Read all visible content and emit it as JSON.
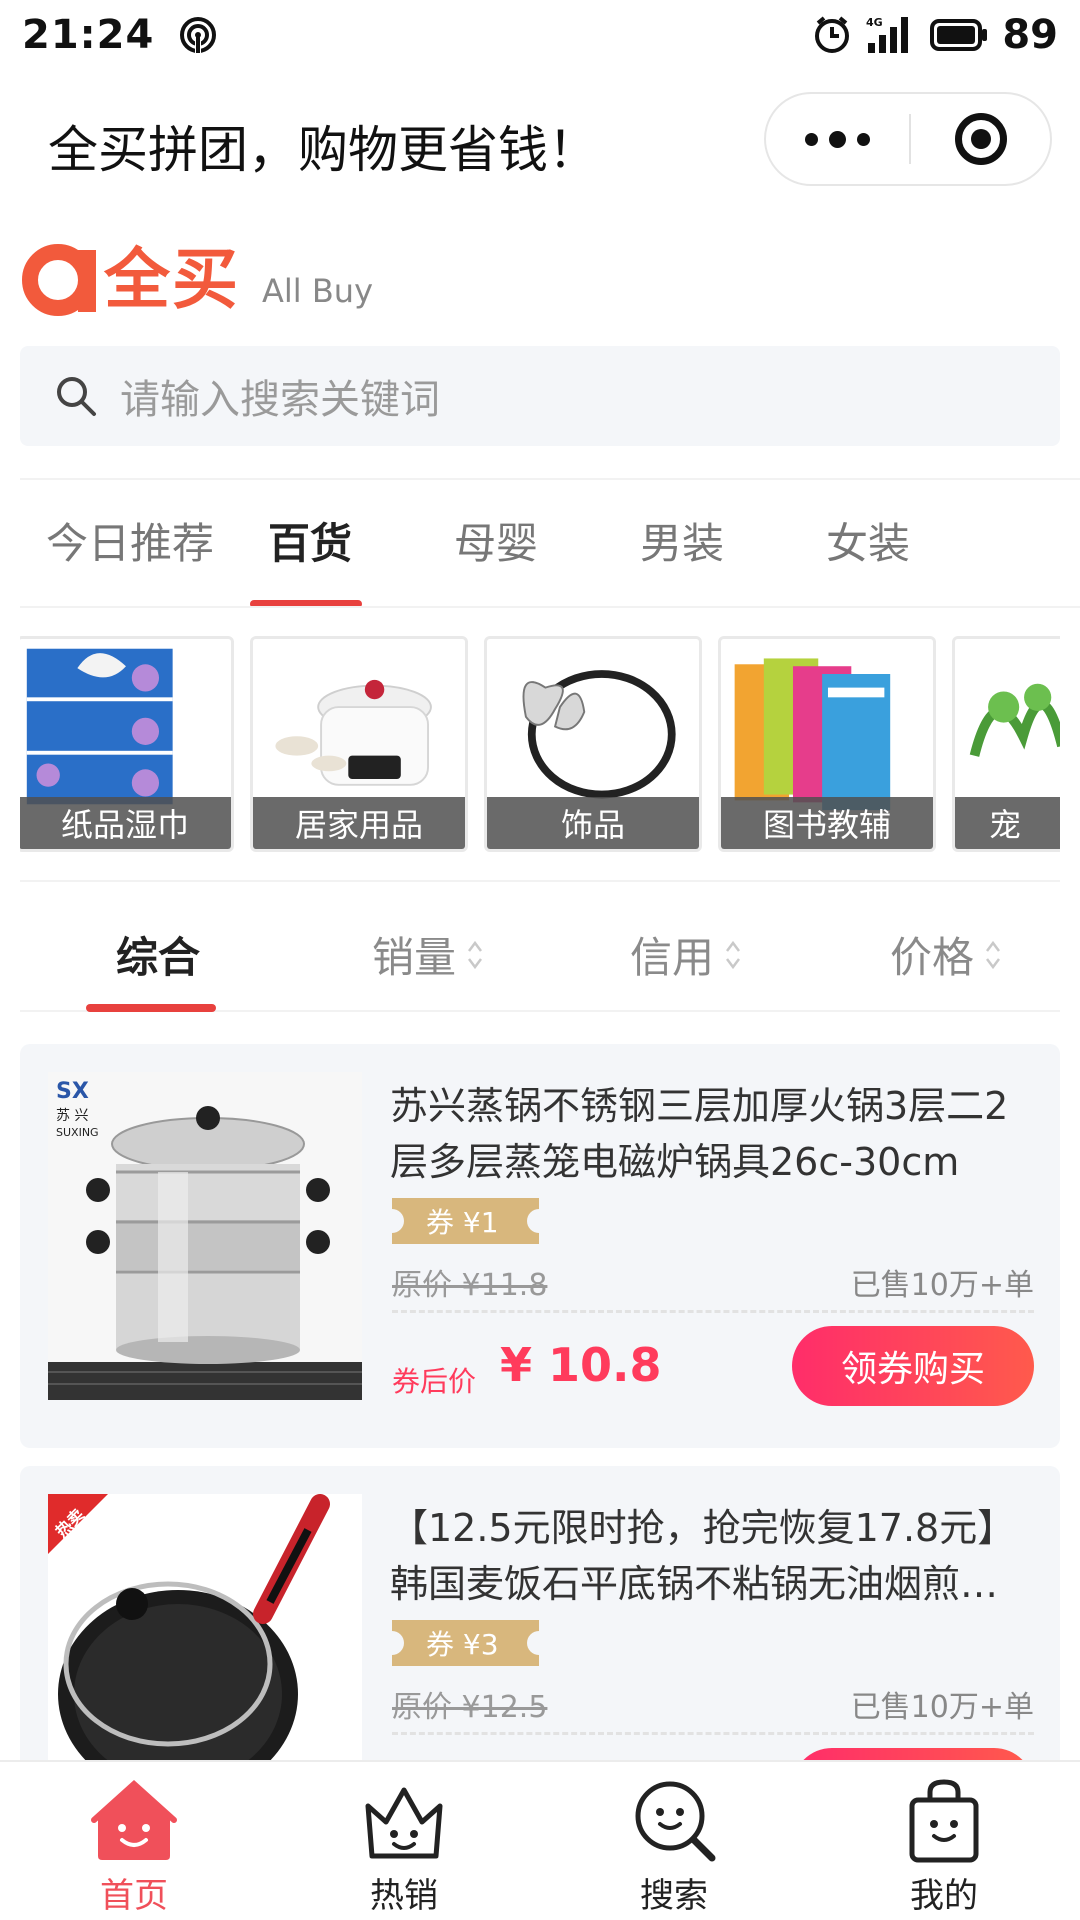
{
  "status_bar": {
    "time": "21:24",
    "network": "4G",
    "battery": "89"
  },
  "title_bar": {
    "title": "全买拼团，购物更省钱！"
  },
  "logo": {
    "name_cn": "全买",
    "name_en": "All Buy"
  },
  "search": {
    "placeholder": "请输入搜索关键词"
  },
  "category_tabs": [
    {
      "label": "今日推荐",
      "active": false
    },
    {
      "label": "百货",
      "active": true
    },
    {
      "label": "母婴",
      "active": false
    },
    {
      "label": "男装",
      "active": false
    },
    {
      "label": "女装",
      "active": false
    }
  ],
  "subcategories": [
    {
      "label": "纸品湿巾"
    },
    {
      "label": "居家用品"
    },
    {
      "label": "饰品"
    },
    {
      "label": "图书教辅"
    },
    {
      "label": "宠"
    }
  ],
  "sort_bar": [
    {
      "label": "综合",
      "active": true
    },
    {
      "label": "销量",
      "active": false
    },
    {
      "label": "信用",
      "active": false
    },
    {
      "label": "价格",
      "active": false
    }
  ],
  "products": [
    {
      "title": "苏兴蒸锅不锈钢三层加厚火锅3层二2层多层蒸笼电磁炉锅具26c-30cm",
      "coupon": "券 ¥1",
      "original_price": "原价 ¥11.8",
      "sold": "已售10万+单",
      "after_label": "券后价",
      "after_price": "¥ 10.8",
      "button": "领券购买",
      "brand_text": "苏 兴",
      "brand_en": "SUXING"
    },
    {
      "title": "【12.5元限时抢，抢完恢复17.8元】韩国麦饭石平底锅不粘锅无油烟煎…",
      "coupon": "券 ¥3",
      "original_price": "原价 ¥12.5",
      "sold": "已售10万+单",
      "tag": "热卖"
    }
  ],
  "tab_bar": [
    {
      "label": "首页",
      "icon": "home-icon",
      "active": true
    },
    {
      "label": "热销",
      "icon": "crown-icon",
      "active": false
    },
    {
      "label": "搜索",
      "icon": "search-face-icon",
      "active": false
    },
    {
      "label": "我的",
      "icon": "bag-icon",
      "active": false
    }
  ],
  "colors": {
    "brand": "#f25a3c",
    "accent": "#e8413e",
    "price": "#ff3b5c",
    "coupon": "#d8b77d"
  }
}
